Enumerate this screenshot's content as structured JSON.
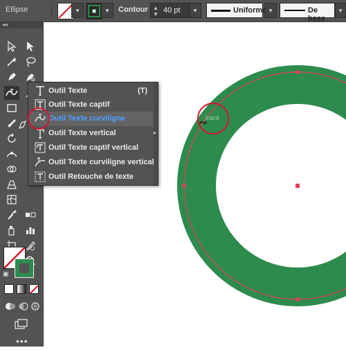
{
  "control_bar": {
    "shape_name": "Ellipse",
    "stroke_label": "Contour :",
    "stroke_weight": "40 pt",
    "profile_label": "Uniforme",
    "brush_label": "De base"
  },
  "flyout": {
    "items": [
      {
        "label": "Outil Texte",
        "shortcut": "(T)",
        "icon": "type-icon",
        "selected": false
      },
      {
        "label": "Outil Texte captif",
        "shortcut": "",
        "icon": "area-type-icon",
        "selected": false
      },
      {
        "label": "Outil Texte curviligne",
        "shortcut": "",
        "icon": "type-on-path-icon",
        "selected": true
      },
      {
        "label": "Outil Texte vertical",
        "shortcut": "",
        "icon": "vertical-type-icon",
        "selected": false
      },
      {
        "label": "Outil Texte captif vertical",
        "shortcut": "",
        "icon": "vertical-area-type-icon",
        "selected": false
      },
      {
        "label": "Outil Texte curviligne vertical",
        "shortcut": "",
        "icon": "vertical-type-on-path-icon",
        "selected": false
      },
      {
        "label": "Outil Retouche de texte",
        "shortcut": "",
        "icon": "touch-type-icon",
        "selected": false
      }
    ]
  },
  "canvas": {
    "cursor_hint": "tracé"
  },
  "colors": {
    "ring_fill": "#2e8b4e",
    "path_stroke": "#e0405a",
    "callout": "#d2162d",
    "selected_text": "#4ea0ff",
    "ui_bg": "#535353"
  }
}
